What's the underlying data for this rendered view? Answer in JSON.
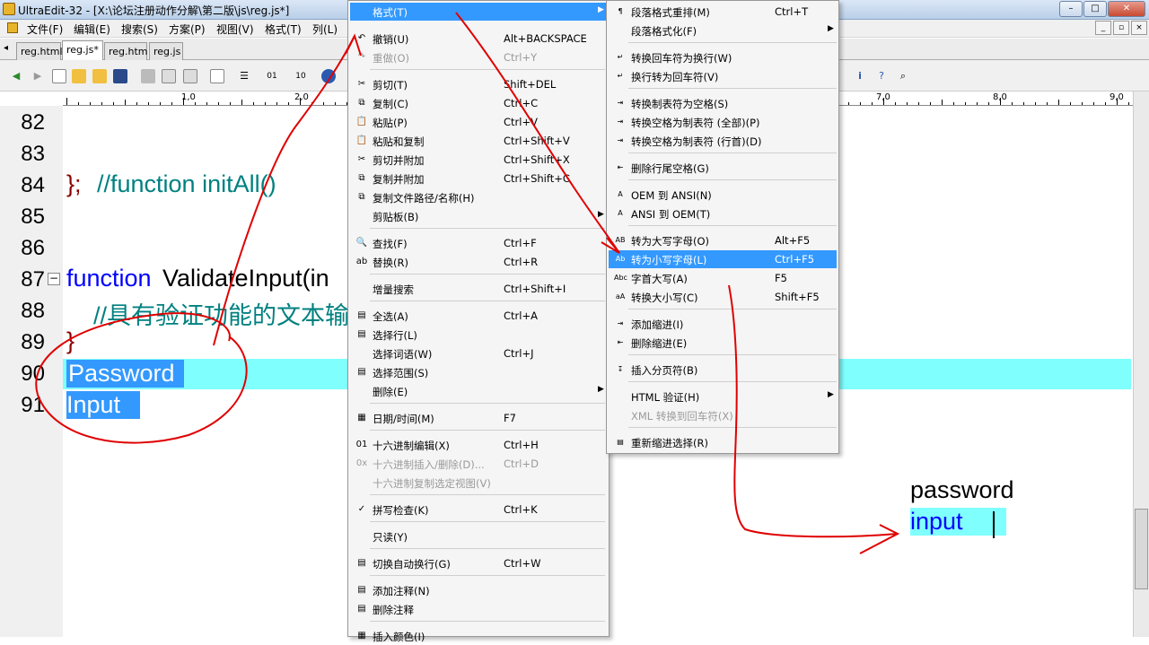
{
  "window": {
    "title": "UltraEdit-32 - [X:\\论坛注册动作分解\\第二版\\js\\reg.js*]",
    "min": "–",
    "max": "□",
    "close": "✕"
  },
  "menubar": {
    "items": [
      "文件(F)",
      "编辑(E)",
      "搜索(S)",
      "方案(P)",
      "视图(V)",
      "格式(T)",
      "列(L)"
    ],
    "mdi": [
      "_",
      "▫",
      "×"
    ]
  },
  "tabs": [
    "reg.html",
    "reg.js*",
    "reg.htm",
    "reg.js"
  ],
  "ruler": {
    "labels": [
      "1,0",
      "2,0",
      "7,0",
      "8,0",
      "9,0"
    ]
  },
  "lines": [
    "82",
    "83",
    "84",
    "85",
    "86",
    "87",
    "88",
    "89",
    "90",
    "91"
  ],
  "code": {
    "l84_brace": "};",
    "l84_comment": "//function initAll()",
    "l87_kw": "function",
    "l87_name": " ValidateInput(in",
    "l88_comment": "//具有验证功能的文本输",
    "l89_brace": "}",
    "l90": "Password",
    "l91": "Input"
  },
  "result": {
    "line1": "password",
    "line2": "input"
  },
  "edit_menu": {
    "header": "格式(T)",
    "items": [
      {
        "label": "撤销(U)",
        "sc": "Alt+BACKSPACE",
        "icon": "↶"
      },
      {
        "label": "重做(O)",
        "sc": "Ctrl+Y",
        "icon": "↷"
      },
      {
        "label": "剪切(T)",
        "sc": "Shift+DEL",
        "icon": "✂"
      },
      {
        "label": "复制(C)",
        "sc": "Ctrl+C",
        "icon": "⧉"
      },
      {
        "label": "粘贴(P)",
        "sc": "Ctrl+V",
        "icon": "📋"
      },
      {
        "label": "粘贴和复制",
        "sc": "Ctrl+Shift+V",
        "icon": "📋"
      },
      {
        "label": "剪切并附加",
        "sc": "Ctrl+Shift+X",
        "icon": "✂"
      },
      {
        "label": "复制并附加",
        "sc": "Ctrl+Shift+C",
        "icon": "⧉"
      },
      {
        "label": "复制文件路径/名称(H)",
        "sc": "",
        "icon": "⧉"
      },
      {
        "label": "剪贴板(B)",
        "sc": "",
        "icon": ""
      },
      {
        "label": "查找(F)",
        "sc": "Ctrl+F",
        "icon": "🔍"
      },
      {
        "label": "替换(R)",
        "sc": "Ctrl+R",
        "icon": "ab"
      },
      {
        "label": "增量搜索",
        "sc": "Ctrl+Shift+I",
        "icon": ""
      },
      {
        "label": "全选(A)",
        "sc": "Ctrl+A",
        "icon": "▤"
      },
      {
        "label": "选择行(L)",
        "sc": "",
        "icon": "▤"
      },
      {
        "label": "选择词语(W)",
        "sc": "Ctrl+J",
        "icon": ""
      },
      {
        "label": "选择范围(S)",
        "sc": "",
        "icon": "▤"
      },
      {
        "label": "删除(E)",
        "sc": "",
        "icon": ""
      },
      {
        "label": "日期/时间(M)",
        "sc": "F7",
        "icon": "▦"
      },
      {
        "label": "十六进制编辑(X)",
        "sc": "Ctrl+H",
        "icon": "01"
      },
      {
        "label": "十六进制插入/删除(D)...",
        "sc": "Ctrl+D",
        "icon": "0x"
      },
      {
        "label": "十六进制复制选定视图(V)",
        "sc": "",
        "icon": ""
      },
      {
        "label": "拼写检查(K)",
        "sc": "Ctrl+K",
        "icon": "✓"
      },
      {
        "label": "只读(Y)",
        "sc": "",
        "icon": ""
      },
      {
        "label": "切换自动换行(G)",
        "sc": "Ctrl+W",
        "icon": "▤"
      },
      {
        "label": "添加注释(N)",
        "sc": "",
        "icon": "▤"
      },
      {
        "label": "删除注释",
        "sc": "",
        "icon": "▤"
      },
      {
        "label": "插入颜色(I)",
        "sc": "",
        "icon": "▦"
      }
    ]
  },
  "format_menu": {
    "items": [
      {
        "label": "段落格式重排(M)",
        "sc": "Ctrl+T",
        "icon": "¶"
      },
      {
        "label": "段落格式化(F)",
        "sc": "",
        "icon": ""
      },
      {
        "label": "转换回车符为换行(W)",
        "sc": "",
        "icon": "↵"
      },
      {
        "label": "换行转为回车符(V)",
        "sc": "",
        "icon": "↵"
      },
      {
        "label": "转换制表符为空格(S)",
        "sc": "",
        "icon": "⇥"
      },
      {
        "label": "转换空格为制表符 (全部)(P)",
        "sc": "",
        "icon": "⇥"
      },
      {
        "label": "转换空格为制表符 (行首)(D)",
        "sc": "",
        "icon": "⇥"
      },
      {
        "label": "删除行尾空格(G)",
        "sc": "",
        "icon": "⇤"
      },
      {
        "label": "OEM 到 ANSI(N)",
        "sc": "",
        "icon": "A"
      },
      {
        "label": "ANSI 到 OEM(T)",
        "sc": "",
        "icon": "A"
      },
      {
        "label": "转为大写字母(O)",
        "sc": "Alt+F5",
        "icon": "AB"
      },
      {
        "label": "转为小写字母(L)",
        "sc": "Ctrl+F5",
        "icon": "Ab"
      },
      {
        "label": "字首大写(A)",
        "sc": "F5",
        "icon": "Abc"
      },
      {
        "label": "转换大小写(C)",
        "sc": "Shift+F5",
        "icon": "aA"
      },
      {
        "label": "添加缩进(I)",
        "sc": "",
        "icon": "⇥"
      },
      {
        "label": "删除缩进(E)",
        "sc": "",
        "icon": "⇤"
      },
      {
        "label": "插入分页符(B)",
        "sc": "",
        "icon": "↧"
      },
      {
        "label": "HTML 验证(H)",
        "sc": "",
        "icon": ""
      },
      {
        "label": "XML 转换到回车符(X)",
        "sc": "",
        "icon": ""
      },
      {
        "label": "重新缩进选择(R)",
        "sc": "",
        "icon": "▤"
      }
    ]
  },
  "colors": {
    "accent": "#3399ff",
    "annotation": "#e00000",
    "highlight_line": "#80ffff",
    "selection": "#3399ff"
  }
}
